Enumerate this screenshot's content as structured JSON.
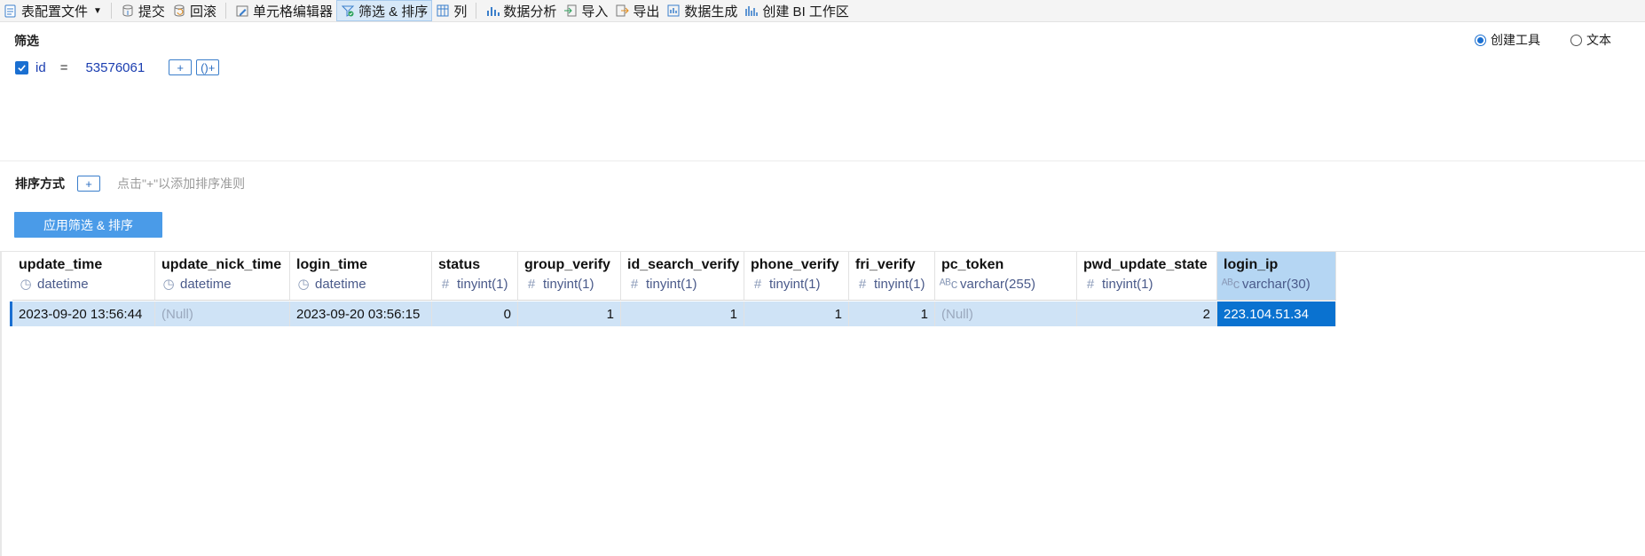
{
  "toolbar": {
    "items": [
      {
        "label": "表配置文件",
        "icon": "table-config-icon",
        "dropdown": true
      },
      {
        "label": "提交",
        "icon": "commit-icon"
      },
      {
        "label": "回滚",
        "icon": "rollback-icon"
      },
      {
        "label": "单元格编辑器",
        "icon": "cell-editor-icon"
      },
      {
        "label": "筛选 & 排序",
        "icon": "filter-sort-icon",
        "active": true
      },
      {
        "label": "列",
        "icon": "columns-icon"
      },
      {
        "label": "数据分析",
        "icon": "data-analysis-icon"
      },
      {
        "label": "导入",
        "icon": "import-icon"
      },
      {
        "label": "导出",
        "icon": "export-icon"
      },
      {
        "label": "数据生成",
        "icon": "data-generate-icon"
      },
      {
        "label": "创建 BI 工作区",
        "icon": "bi-workspace-icon"
      }
    ]
  },
  "filter": {
    "title": "筛选",
    "mode_options": [
      {
        "label": "创建工具",
        "selected": true
      },
      {
        "label": "文本",
        "selected": false
      }
    ],
    "condition": {
      "checked": true,
      "field": "id",
      "operator": "=",
      "value": "53576061"
    },
    "add_label": "+",
    "group_label": "()+"
  },
  "sort": {
    "title": "排序方式",
    "add_label": "+",
    "hint": "点击\"+\"以添加排序准则"
  },
  "apply_button": "应用筛选 & 排序",
  "grid": {
    "columns": [
      {
        "name": "update_time",
        "type": "datetime",
        "type_icon": "clock-icon",
        "width": 161
      },
      {
        "name": "update_nick_time",
        "type": "datetime",
        "type_icon": "clock-icon",
        "width": 152
      },
      {
        "name": "login_time",
        "type": "datetime",
        "type_icon": "clock-icon",
        "width": 160
      },
      {
        "name": "status",
        "type": "tinyint(1)",
        "type_icon": "hash-icon",
        "width": 97
      },
      {
        "name": "group_verify",
        "type": "tinyint(1)",
        "type_icon": "hash-icon",
        "width": 116
      },
      {
        "name": "id_search_verify",
        "type": "tinyint(1)",
        "type_icon": "hash-icon",
        "width": 139
      },
      {
        "name": "phone_verify",
        "type": "tinyint(1)",
        "type_icon": "hash-icon",
        "width": 118
      },
      {
        "name": "fri_verify",
        "type": "tinyint(1)",
        "type_icon": "hash-icon",
        "width": 97
      },
      {
        "name": "pc_token",
        "type": "varchar(255)",
        "type_icon": "abc-icon",
        "width": 160
      },
      {
        "name": "pwd_update_state",
        "type": "tinyint(1)",
        "type_icon": "hash-icon",
        "width": 158
      },
      {
        "name": "login_ip",
        "type": "varchar(30)",
        "type_icon": "abc-icon",
        "width": 134,
        "selected": true
      }
    ],
    "rows": [
      [
        "2023-09-20 13:56:44",
        "(Null)",
        "2023-09-20 03:56:15",
        "0",
        "1",
        "1",
        "1",
        "1",
        "(Null)",
        "2",
        "223.104.51.34"
      ]
    ]
  },
  "colors": {
    "accent": "#1a6fd1",
    "selected_cell": "#0a72d0",
    "row_highlight": "#cfe3f6",
    "apply_button": "#4a9be8"
  }
}
